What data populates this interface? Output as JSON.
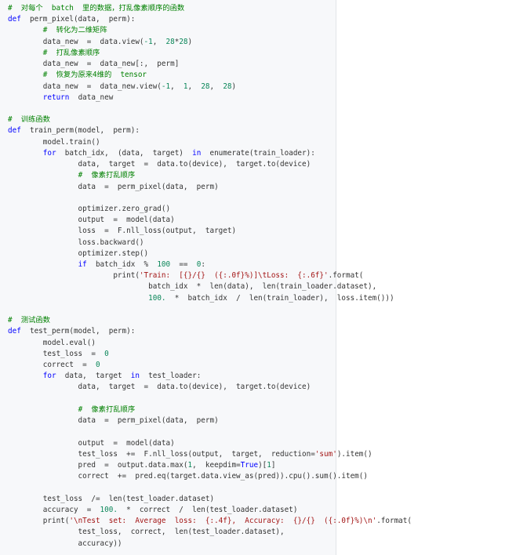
{
  "colors": {
    "background": "#ffffff",
    "code_background": "#f7f8fa",
    "border": "#e3e5e8",
    "plain": "#333333",
    "keyword": "#0000ff",
    "comment": "#008000",
    "string": "#a31515",
    "number": "#098658"
  },
  "code_lines": [
    [
      [
        "cm",
        "#  对每个  batch  里的数据，打乱像素顺序的函数"
      ]
    ],
    [
      [
        "kw",
        "def"
      ],
      [
        "pl",
        "  perm_pixel(data,  perm):"
      ]
    ],
    [
      [
        "pl",
        "        "
      ],
      [
        "cm",
        "#  转化为二维矩阵"
      ]
    ],
    [
      [
        "pl",
        "        data_new  =  data.view("
      ],
      [
        "nm",
        "-1"
      ],
      [
        "pl",
        ",  "
      ],
      [
        "nm",
        "28"
      ],
      [
        "pl",
        "*"
      ],
      [
        "nm",
        "28"
      ],
      [
        "pl",
        ")"
      ]
    ],
    [
      [
        "pl",
        "        "
      ],
      [
        "cm",
        "#  打乱像素顺序"
      ]
    ],
    [
      [
        "pl",
        "        data_new  =  data_new[:,  perm]"
      ]
    ],
    [
      [
        "pl",
        "        "
      ],
      [
        "cm",
        "#  恢复为原来4维的  tensor"
      ]
    ],
    [
      [
        "pl",
        "        data_new  =  data_new.view("
      ],
      [
        "nm",
        "-1"
      ],
      [
        "pl",
        ",  "
      ],
      [
        "nm",
        "1"
      ],
      [
        "pl",
        ",  "
      ],
      [
        "nm",
        "28"
      ],
      [
        "pl",
        ",  "
      ],
      [
        "nm",
        "28"
      ],
      [
        "pl",
        ")"
      ]
    ],
    [
      [
        "pl",
        "        "
      ],
      [
        "kw",
        "return"
      ],
      [
        "pl",
        "  data_new"
      ]
    ],
    [
      [
        "pl",
        ""
      ]
    ],
    [
      [
        "cm",
        "#  训练函数"
      ]
    ],
    [
      [
        "kw",
        "def"
      ],
      [
        "pl",
        "  train_perm(model,  perm):"
      ]
    ],
    [
      [
        "pl",
        "        model.train()"
      ]
    ],
    [
      [
        "pl",
        "        "
      ],
      [
        "kw",
        "for"
      ],
      [
        "pl",
        "  batch_idx,  (data,  target)  "
      ],
      [
        "kw",
        "in"
      ],
      [
        "pl",
        "  enumerate(train_loader):"
      ]
    ],
    [
      [
        "pl",
        "                data,  target  =  data.to(device),  target.to(device)"
      ]
    ],
    [
      [
        "pl",
        "                "
      ],
      [
        "cm",
        "#  像素打乱顺序"
      ]
    ],
    [
      [
        "pl",
        "                data  =  perm_pixel(data,  perm)"
      ]
    ],
    [
      [
        "pl",
        ""
      ]
    ],
    [
      [
        "pl",
        "                optimizer.zero_grad()"
      ]
    ],
    [
      [
        "pl",
        "                output  =  model(data)"
      ]
    ],
    [
      [
        "pl",
        "                loss  =  F.nll_loss(output,  target)"
      ]
    ],
    [
      [
        "pl",
        "                loss.backward()"
      ]
    ],
    [
      [
        "pl",
        "                optimizer.step()"
      ]
    ],
    [
      [
        "pl",
        "                "
      ],
      [
        "kw",
        "if"
      ],
      [
        "pl",
        "  batch_idx  %  "
      ],
      [
        "nm",
        "100"
      ],
      [
        "pl",
        "  ==  "
      ],
      [
        "nm",
        "0"
      ],
      [
        "pl",
        ":"
      ]
    ],
    [
      [
        "pl",
        "                        print("
      ],
      [
        "st",
        "'Train:  [{}/{}  ({:.0f}%)]\\tLoss:  {:.6f}'"
      ],
      [
        "pl",
        ".format("
      ]
    ],
    [
      [
        "pl",
        "                                batch_idx  *  len(data),  len(train_loader.dataset),"
      ]
    ],
    [
      [
        "pl",
        "                                "
      ],
      [
        "nm",
        "100."
      ],
      [
        "pl",
        "  *  batch_idx  /  len(train_loader),  loss.item()))"
      ]
    ],
    [
      [
        "pl",
        ""
      ]
    ],
    [
      [
        "cm",
        "#  测试函数"
      ]
    ],
    [
      [
        "kw",
        "def"
      ],
      [
        "pl",
        "  test_perm(model,  perm):"
      ]
    ],
    [
      [
        "pl",
        "        model.eval()"
      ]
    ],
    [
      [
        "pl",
        "        test_loss  =  "
      ],
      [
        "nm",
        "0"
      ]
    ],
    [
      [
        "pl",
        "        correct  =  "
      ],
      [
        "nm",
        "0"
      ]
    ],
    [
      [
        "pl",
        "        "
      ],
      [
        "kw",
        "for"
      ],
      [
        "pl",
        "  data,  target  "
      ],
      [
        "kw",
        "in"
      ],
      [
        "pl",
        "  test_loader:"
      ]
    ],
    [
      [
        "pl",
        "                data,  target  =  data.to(device),  target.to(device)"
      ]
    ],
    [
      [
        "pl",
        ""
      ]
    ],
    [
      [
        "pl",
        "                "
      ],
      [
        "cm",
        "#  像素打乱顺序"
      ]
    ],
    [
      [
        "pl",
        "                data  =  perm_pixel(data,  perm)"
      ]
    ],
    [
      [
        "pl",
        ""
      ]
    ],
    [
      [
        "pl",
        "                output  =  model(data)"
      ]
    ],
    [
      [
        "pl",
        "                test_loss  +=  F.nll_loss(output,  target,  reduction="
      ],
      [
        "st",
        "'sum'"
      ],
      [
        "pl",
        ").item()"
      ]
    ],
    [
      [
        "pl",
        "                pred  =  output.data.max("
      ],
      [
        "nm",
        "1"
      ],
      [
        "pl",
        ",  keepdim="
      ],
      [
        "kw",
        "True"
      ],
      [
        "pl",
        ")["
      ],
      [
        "nm",
        "1"
      ],
      [
        "pl",
        "]"
      ]
    ],
    [
      [
        "pl",
        "                correct  +=  pred.eq(target.data.view_as(pred)).cpu().sum().item()"
      ]
    ],
    [
      [
        "pl",
        ""
      ]
    ],
    [
      [
        "pl",
        "        test_loss  /=  len(test_loader.dataset)"
      ]
    ],
    [
      [
        "pl",
        "        accuracy  =  "
      ],
      [
        "nm",
        "100."
      ],
      [
        "pl",
        "  *  correct  /  len(test_loader.dataset)"
      ]
    ],
    [
      [
        "pl",
        "        print("
      ],
      [
        "st",
        "'\\nTest  set:  Average  loss:  {:.4f},  Accuracy:  {}/{}  ({:.0f}%)\\n'"
      ],
      [
        "pl",
        ".format("
      ]
    ],
    [
      [
        "pl",
        "                test_loss,  correct,  len(test_loader.dataset),"
      ]
    ],
    [
      [
        "pl",
        "                accuracy))"
      ]
    ]
  ]
}
